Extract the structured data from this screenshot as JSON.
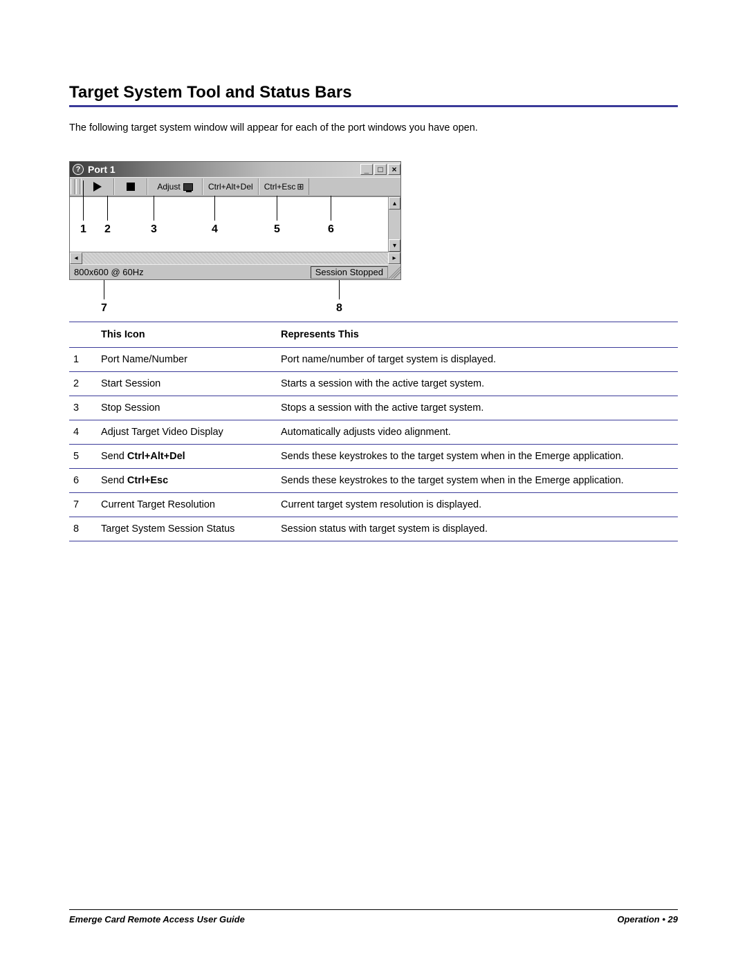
{
  "heading": "Target System Tool and Status Bars",
  "intro": "The following target system window will appear for each of the port windows you have open.",
  "window": {
    "title": "Port 1",
    "toolbar": {
      "adjust_label": "Adjust",
      "cad_label": "Ctrl+Alt+Del",
      "cesc_label": "Ctrl+Esc"
    },
    "status": {
      "resolution": "800x600 @ 60Hz",
      "session": "Session Stopped"
    }
  },
  "callouts": [
    "1",
    "2",
    "3",
    "4",
    "5",
    "6",
    "7",
    "8"
  ],
  "table": {
    "col1": "This Icon",
    "col2": "Represents This",
    "rows": [
      {
        "n": "1",
        "icon": "Port Name/Number",
        "desc": "Port name/number of target system is displayed."
      },
      {
        "n": "2",
        "icon": "Start Session",
        "desc": "Starts a session with the active target system."
      },
      {
        "n": "3",
        "icon": "Stop Session",
        "desc": "Stops a session with the active target system."
      },
      {
        "n": "4",
        "icon": "Adjust Target Video Display",
        "desc": "Automatically adjusts video alignment."
      },
      {
        "n": "5",
        "icon_pre": "Send ",
        "icon_b": "Ctrl+Alt+Del",
        "desc": "Sends these keystrokes to the target system when in the Emerge application."
      },
      {
        "n": "6",
        "icon_pre": "Send ",
        "icon_b": "Ctrl+Esc",
        "desc": "Sends these keystrokes to the target system when in the Emerge application."
      },
      {
        "n": "7",
        "icon": "Current Target Resolution",
        "desc": "Current target system resolution is displayed."
      },
      {
        "n": "8",
        "icon": "Target System Session Status",
        "desc": "Session status with target system is displayed."
      }
    ]
  },
  "footer": {
    "left": "Emerge Card Remote Access User Guide",
    "right_label": "Operation",
    "right_sep": " • ",
    "right_page": "29"
  }
}
